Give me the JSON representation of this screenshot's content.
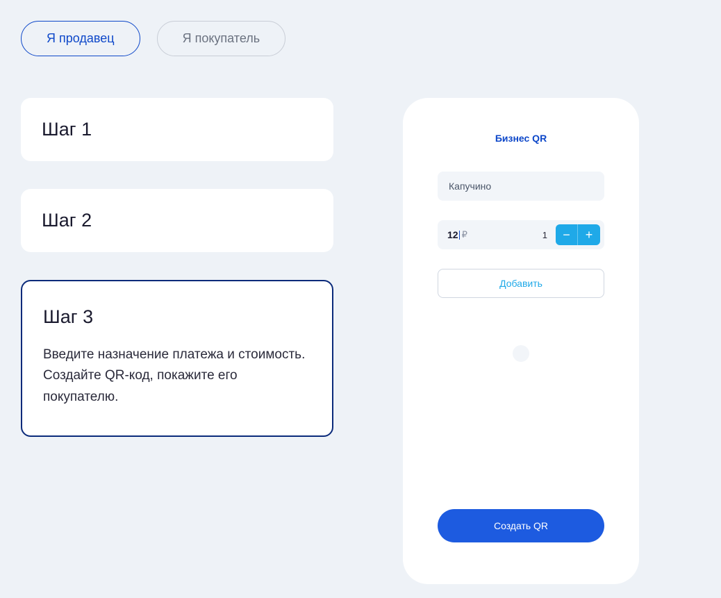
{
  "tabs": {
    "seller": "Я продавец",
    "buyer": "Я покупатель"
  },
  "steps": {
    "step1": {
      "title": "Шаг 1"
    },
    "step2": {
      "title": "Шаг 2"
    },
    "step3": {
      "title": "Шаг 3",
      "description": "Введите назначение платежа и стоимость. Создайте QR-код, покажите его покупателю."
    }
  },
  "phone": {
    "title": "Бизнес QR",
    "product_name": "Капучино",
    "price": "12",
    "currency": "₽",
    "quantity": "1",
    "minus_label": "−",
    "plus_label": "+",
    "add_button": "Добавить",
    "create_qr": "Создать QR"
  }
}
